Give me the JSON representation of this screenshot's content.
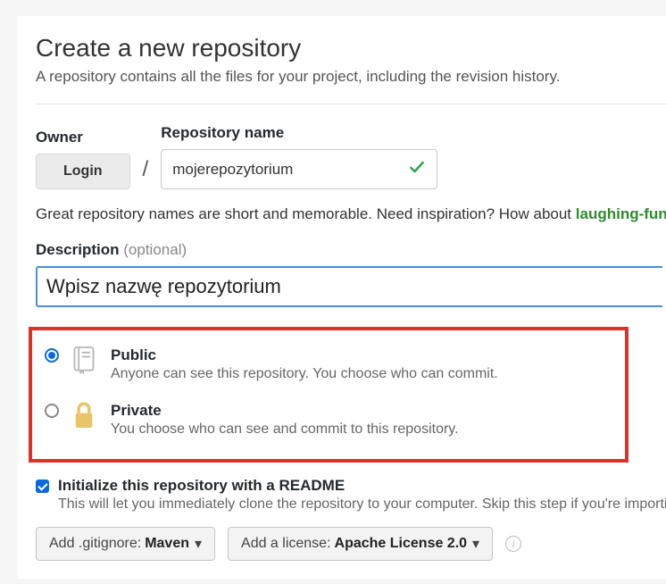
{
  "header": {
    "title": "Create a new repository",
    "subtitle": "A repository contains all the files for your project, including the revision history."
  },
  "owner": {
    "label": "Owner",
    "login": "Login"
  },
  "repo_name": {
    "label": "Repository name",
    "value": "mojerepozytorium"
  },
  "name_hint": {
    "prefix": "Great repository names are short and memorable. Need inspiration? How about ",
    "suggestion": "laughing-funicu"
  },
  "description": {
    "label": "Description",
    "optional": "(optional)",
    "value": "Wpisz nazwę repozytorium"
  },
  "visibility": {
    "public": {
      "title": "Public",
      "sub": "Anyone can see this repository. You choose who can commit."
    },
    "private": {
      "title": "Private",
      "sub": "You choose who can see and commit to this repository."
    }
  },
  "readme": {
    "title": "Initialize this repository with a README",
    "sub": "This will let you immediately clone the repository to your computer. Skip this step if you're importing an"
  },
  "dropdowns": {
    "gitignore_prefix": "Add .gitignore:",
    "gitignore_value": "Maven",
    "license_prefix": "Add a license:",
    "license_value": "Apache License 2.0"
  }
}
